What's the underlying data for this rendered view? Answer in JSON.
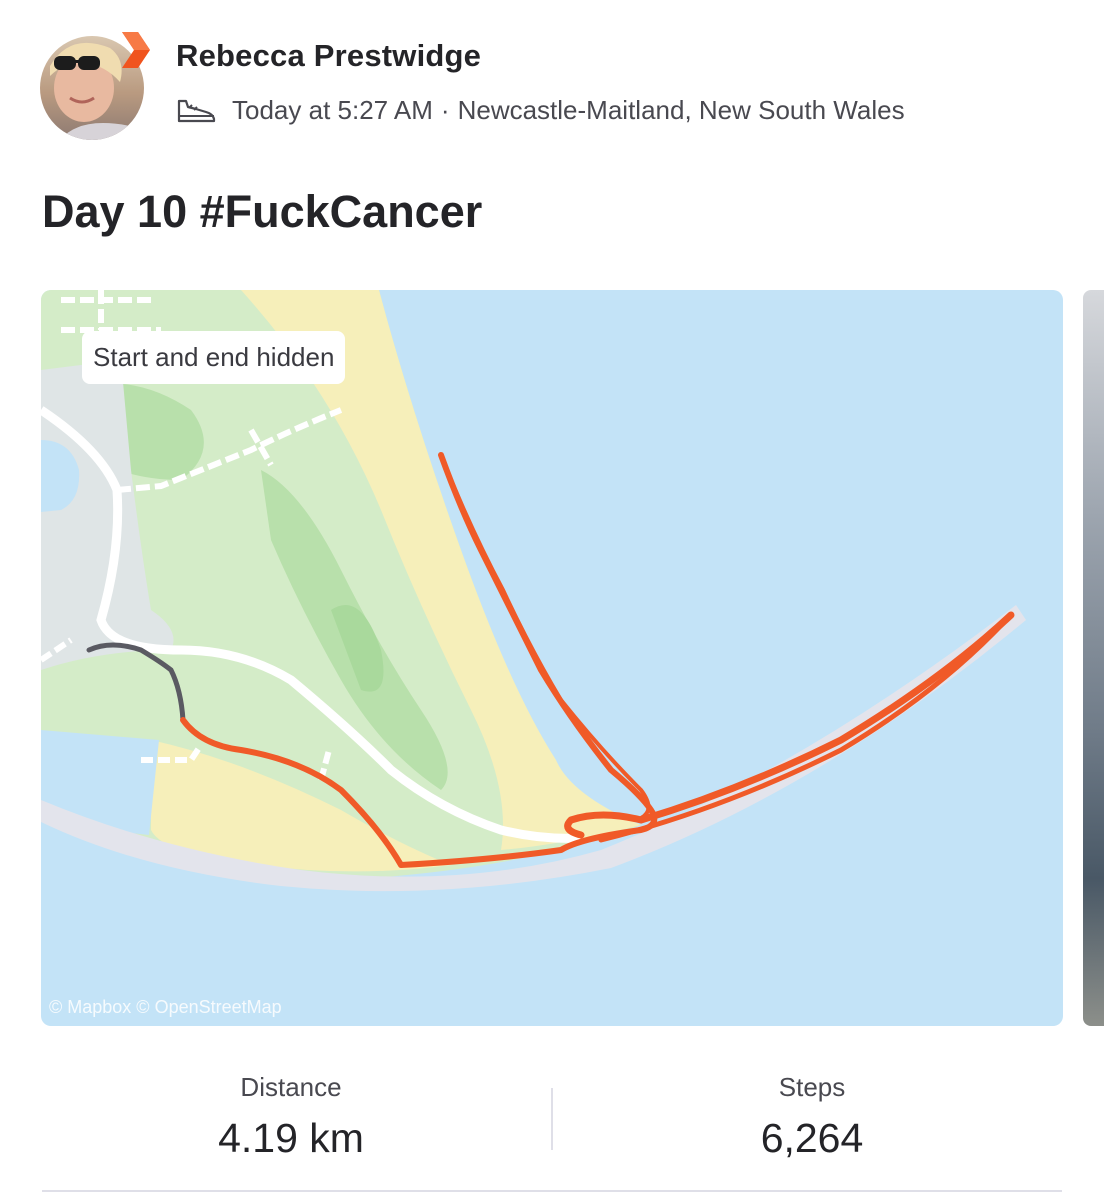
{
  "athlete": {
    "name": "Rebecca Prestwidge",
    "activity_icon": "shoe-icon",
    "time": "Today at 5:27 AM",
    "separator": "·",
    "location": "Newcastle-Maitland, New South Wales",
    "badge_icon": "subscriber-chevron-icon"
  },
  "activity": {
    "title": "Day 10 #FuckCancer"
  },
  "map": {
    "privacy_label": "Start and end hidden",
    "attribution": "© Mapbox © OpenStreetMap",
    "colors": {
      "water": "#c3e3f7",
      "park": "#d4ecc8",
      "sand": "#f6efba",
      "route": "#f05a28",
      "hidden_route": "#5a5a62"
    }
  },
  "stats": {
    "distance_label": "Distance",
    "distance_value": "4.19 km",
    "steps_label": "Steps",
    "steps_value": "6,264"
  }
}
